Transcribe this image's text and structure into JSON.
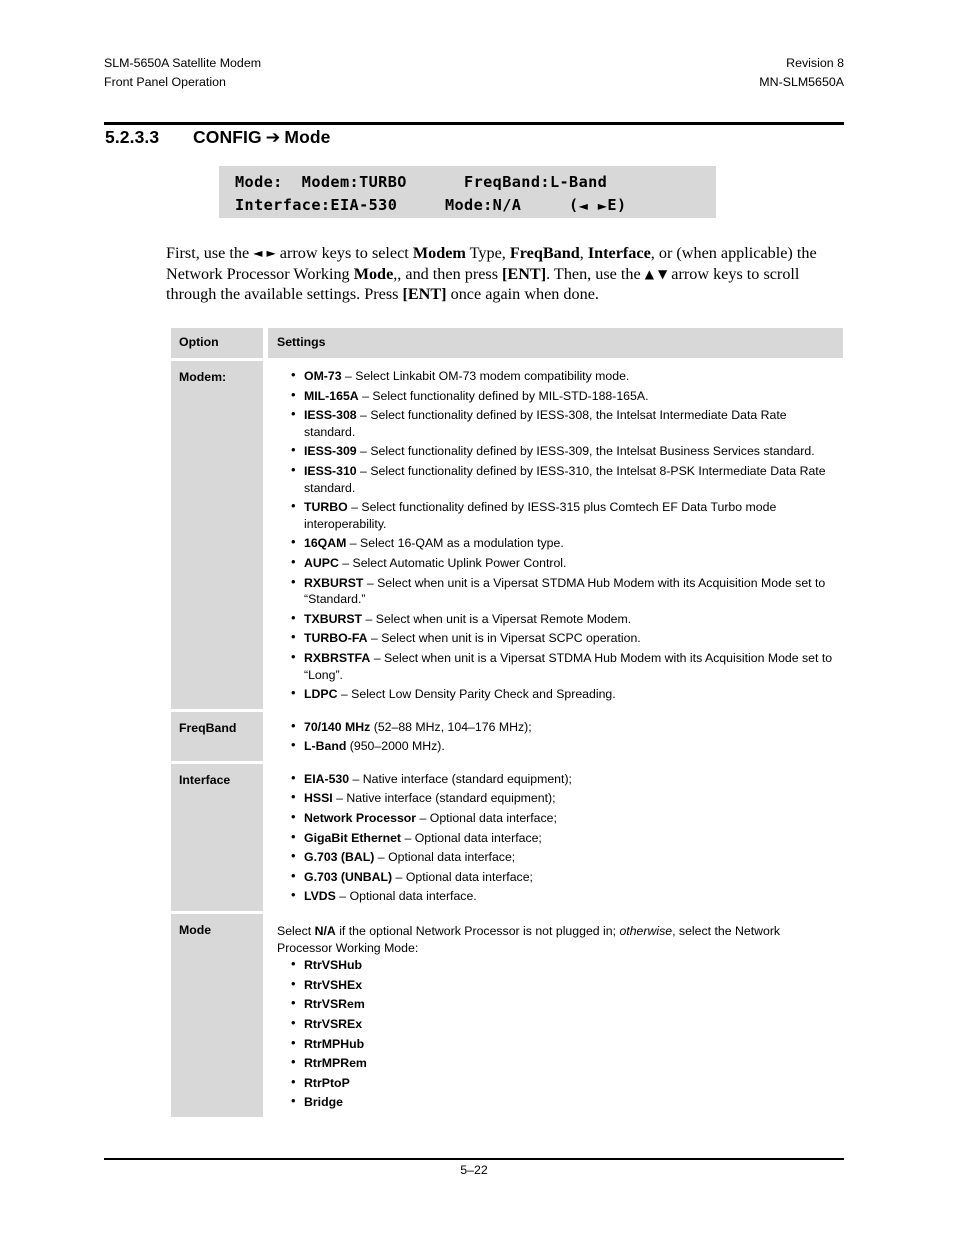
{
  "header": {
    "left_line1": "SLM-5650A Satellite Modem",
    "left_line2": "Front Panel Operation",
    "right_line1": "Revision 8",
    "right_line2": "MN-SLM5650A"
  },
  "section": {
    "number": "5.2.3.3",
    "title_before": "CONFIG",
    "arrow": "➔",
    "title_after": "Mode"
  },
  "lcd": {
    "line1": "Mode:  Modem:TURBO      FreqBand:L-Band",
    "line2_a": "Interface:EIA-530     Mode:N/A     (",
    "line2_left_arrow": "◄",
    "line2_mid": " ",
    "line2_right_arrow": "►",
    "line2_b": "E)"
  },
  "paragraph": {
    "p1_a": "First, use the ",
    "p1_left_arrow": "◄",
    "p1_right_arrow": "►",
    "p1_b": " arrow keys to select ",
    "bold_modem": "Modem",
    "p1_c": " Type, ",
    "bold_freqband": "FreqBand",
    "p1_d": ", ",
    "bold_interface": "Interface",
    "p1_e": ", or (when applicable) the Network Processor Working ",
    "bold_mode": "Mode",
    "p1_f": ",, and then press ",
    "bold_ent1": "[ENT]",
    "p1_g": ". Then, use the ",
    "p1_up_arrow": "▲",
    "p1_down_arrow": "▼",
    "p1_h": " arrow keys to scroll through the available settings. Press ",
    "bold_ent2": "[ENT]",
    "p1_i": " once again when done."
  },
  "table": {
    "columns": [
      "Option",
      "Settings"
    ],
    "rows": [
      {
        "option": "Modem:",
        "intro": "",
        "items": [
          {
            "term": "OM-73",
            "desc": " – Select Linkabit OM-73 modem compatibility mode."
          },
          {
            "term": "MIL-165A",
            "desc": " – Select functionality defined by MIL-STD-188-165A."
          },
          {
            "term": "IESS-308",
            "desc": " – Select functionality defined by IESS-308, the Intelsat Intermediate Data Rate standard."
          },
          {
            "term": "IESS-309",
            "desc": " – Select functionality defined by IESS-309, the Intelsat Business Services standard."
          },
          {
            "term": "IESS-310",
            "desc": " – Select functionality defined by IESS-310, the Intelsat 8-PSK Intermediate Data Rate standard."
          },
          {
            "term": "TURBO",
            "desc": " – Select functionality defined by IESS-315 plus Comtech EF Data Turbo mode interoperability."
          },
          {
            "term": "16QAM",
            "desc": " – Select 16-QAM as a modulation type."
          },
          {
            "term": "AUPC",
            "desc": " – Select  Automatic Uplink Power Control."
          },
          {
            "term": "RXBURST",
            "desc": " – Select when unit is a Vipersat STDMA Hub Modem with its Acquisition Mode set to “Standard.”"
          },
          {
            "term": "TXBURST",
            "desc": " – Select when unit is a Vipersat Remote Modem."
          },
          {
            "term": "TURBO-FA",
            "desc": " – Select when unit is in Vipersat SCPC operation."
          },
          {
            "term": "RXBRSTFA",
            "desc": " – Select when unit is a Vipersat STDMA Hub Modem with its Acquisition Mode set to “Long”."
          },
          {
            "term": "LDPC",
            "desc": " – Select Low Density Parity Check and Spreading."
          }
        ]
      },
      {
        "option": "FreqBand",
        "intro": "",
        "items": [
          {
            "term": "70/140 MHz",
            "desc": " (52–88 MHz, 104–176 MHz);"
          },
          {
            "term": "L-Band",
            "desc": " (950–2000 MHz)."
          }
        ]
      },
      {
        "option": "Interface",
        "intro": "",
        "items": [
          {
            "term": "EIA-530",
            "desc": " – Native interface (standard equipment);"
          },
          {
            "term": "HSSI",
            "desc": " –  Native interface (standard equipment);"
          },
          {
            "term": "Network Processor",
            "desc": " –  Optional data interface;"
          },
          {
            "term": "GigaBit Ethernet",
            "desc": " –  Optional data interface;"
          },
          {
            "term": "G.703 (BAL)",
            "desc": " –  Optional data interface;"
          },
          {
            "term": "G.703 (UNBAL)",
            "desc": " –  Optional data interface;"
          },
          {
            "term": "LVDS",
            "desc": " – Optional data interface."
          }
        ]
      },
      {
        "option": "Mode",
        "intro_parts": {
          "a": "Select ",
          "bold1": "N/A",
          "b": " if the optional Network Processor is not plugged in; ",
          "italic1": "otherwise",
          "c": ", select the Network Processor Working Mode:"
        },
        "items": [
          {
            "term": "RtrVSHub",
            "desc": ""
          },
          {
            "term": "RtrVSHEx",
            "desc": ""
          },
          {
            "term": "RtrVSRem",
            "desc": ""
          },
          {
            "term": "RtrVSREx",
            "desc": ""
          },
          {
            "term": "RtrMPHub",
            "desc": ""
          },
          {
            "term": "RtrMPRem",
            "desc": ""
          },
          {
            "term": "RtrPtoP",
            "desc": ""
          },
          {
            "term": "Bridge",
            "desc": ""
          }
        ]
      }
    ]
  },
  "footer": {
    "page_number": "5–22"
  },
  "colors": {
    "cell_gray": "#d8d8d8",
    "lcd_gray": "#d8d8d8",
    "rule": "#000000"
  }
}
